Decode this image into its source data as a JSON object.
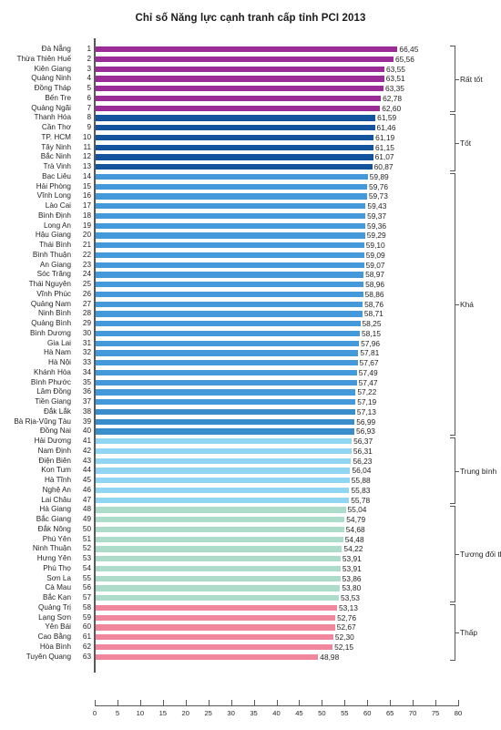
{
  "chart_data": {
    "type": "bar",
    "orientation": "horizontal",
    "title": "Chỉ số Năng lực cạnh tranh cấp tỉnh PCI 2013",
    "xlabel": "",
    "ylabel": "",
    "xlim": [
      0,
      80
    ],
    "xticks": [
      0,
      5,
      10,
      15,
      20,
      25,
      30,
      35,
      40,
      45,
      50,
      55,
      60,
      65,
      70,
      75,
      80
    ],
    "grid": false,
    "legend": "right-brackets",
    "value_decimal_separator": ",",
    "categories": [
      "Đà Nẵng",
      "Thừa Thiên Huế",
      "Kiên Giang",
      "Quảng Ninh",
      "Đồng Tháp",
      "Bến Tre",
      "Quảng Ngãi",
      "Thanh Hóa",
      "Cần Thơ",
      "TP. HCM",
      "Tây Ninh",
      "Bắc Ninh",
      "Trà Vinh",
      "Bạc Liêu",
      "Hải Phòng",
      "Vĩnh Long",
      "Lào Cai",
      "Bình Định",
      "Long An",
      "Hậu Giang",
      "Thái Bình",
      "Bình Thuận",
      "An Giang",
      "Sóc Trăng",
      "Thái Nguyên",
      "Vĩnh Phúc",
      "Quảng Nam",
      "Ninh Bình",
      "Quảng Bình",
      "Bình Dương",
      "Gia Lai",
      "Hà Nam",
      "Hà Nội",
      "Khánh Hòa",
      "Bình Phước",
      "Lâm Đồng",
      "Tiền Giang",
      "Đắk Lắk",
      "Bà Rịa-Vũng Tàu",
      "Đồng Nai",
      "Hải Dương",
      "Nam Định",
      "Điện Biên",
      "Kon Tum",
      "Hà Tĩnh",
      "Nghệ An",
      "Lai Châu",
      "Hà Giang",
      "Bắc Giang",
      "Đắk Nông",
      "Phú Yên",
      "Ninh Thuận",
      "Hưng Yên",
      "Phú Thọ",
      "Sơn La",
      "Cà Mau",
      "Bắc Kạn",
      "Quảng Trị",
      "Lạng Sơn",
      "Yên Bái",
      "Cao Bằng",
      "Hòa Bình",
      "Tuyên Quang"
    ],
    "ranks": [
      1,
      2,
      3,
      4,
      5,
      6,
      7,
      8,
      9,
      10,
      11,
      12,
      13,
      14,
      15,
      16,
      17,
      18,
      19,
      20,
      21,
      22,
      23,
      24,
      25,
      26,
      27,
      28,
      29,
      30,
      31,
      32,
      33,
      34,
      35,
      36,
      37,
      38,
      39,
      40,
      41,
      42,
      43,
      44,
      45,
      46,
      47,
      48,
      49,
      50,
      51,
      52,
      53,
      54,
      55,
      56,
      57,
      58,
      59,
      60,
      61,
      62,
      63
    ],
    "values": [
      66.45,
      65.56,
      63.55,
      63.51,
      63.35,
      62.78,
      62.6,
      61.59,
      61.46,
      61.19,
      61.15,
      61.07,
      60.87,
      59.89,
      59.76,
      59.73,
      59.43,
      59.37,
      59.36,
      59.29,
      59.1,
      59.09,
      59.07,
      58.97,
      58.96,
      58.86,
      58.76,
      58.71,
      58.25,
      58.15,
      57.96,
      57.81,
      57.67,
      57.49,
      57.47,
      57.22,
      57.19,
      57.13,
      56.99,
      56.93,
      56.37,
      56.31,
      56.23,
      56.04,
      55.88,
      55.83,
      55.78,
      55.04,
      54.79,
      54.68,
      54.48,
      54.22,
      53.91,
      53.91,
      53.86,
      53.8,
      53.53,
      53.13,
      52.76,
      52.67,
      52.3,
      52.15,
      48.98
    ],
    "value_labels": [
      "66,45",
      "65,56",
      "63,55",
      "63,51",
      "63,35",
      "62,78",
      "62,60",
      "61,59",
      "61,46",
      "61,19",
      "61,15",
      "61,07",
      "60,87",
      "59,89",
      "59,76",
      "59,73",
      "59,43",
      "59,37",
      "59,36",
      "59,29",
      "59,10",
      "59,09",
      "59,07",
      "58,97",
      "58,96",
      "58,86",
      "58,76",
      "58,71",
      "58,25",
      "58,15",
      "57,96",
      "57,81",
      "57,67",
      "57,49",
      "57,47",
      "57,22",
      "57,19",
      "57,13",
      "56,99",
      "56,93",
      "56,37",
      "56,31",
      "56,23",
      "56,04",
      "55,88",
      "55,83",
      "55,78",
      "55,04",
      "54,79",
      "54,68",
      "54,48",
      "54,22",
      "53,91",
      "53,91",
      "53,86",
      "53,80",
      "53,53",
      "53,13",
      "52,76",
      "52,67",
      "52,30",
      "52,15",
      "48,98"
    ],
    "groups": [
      {
        "label": "Rất tốt",
        "first_rank": 1,
        "last_rank": 7,
        "color": "#9B2B96"
      },
      {
        "label": "Tốt",
        "first_rank": 8,
        "last_rank": 13,
        "color": "#14539E"
      },
      {
        "label": "Khá",
        "first_rank": 14,
        "last_rank": 40,
        "color": "#4399D9"
      },
      {
        "label": "Trung bình",
        "first_rank": 41,
        "last_rank": 47,
        "color": "#90D5F2"
      },
      {
        "label": "Tương đối thấp",
        "first_rank": 48,
        "last_rank": 57,
        "color": "#AEDCCB"
      },
      {
        "label": "Thấp",
        "first_rank": 58,
        "last_rank": 63,
        "color": "#F0879C"
      }
    ],
    "bar_color_overrides": {
      "38": "#3A8DCB",
      "39": "#3A8DCB",
      "40": "#3A8DCB"
    }
  },
  "colors": {
    "axis": "#58595b",
    "text": "#231f20",
    "background": "#ffffff",
    "rat_tot": "#9B2B96",
    "tot": "#14539E",
    "kha": "#4399D9",
    "trung_binh": "#90D5F2",
    "tuong_doi_thap": "#AEDCCB",
    "thap": "#F0879C"
  }
}
